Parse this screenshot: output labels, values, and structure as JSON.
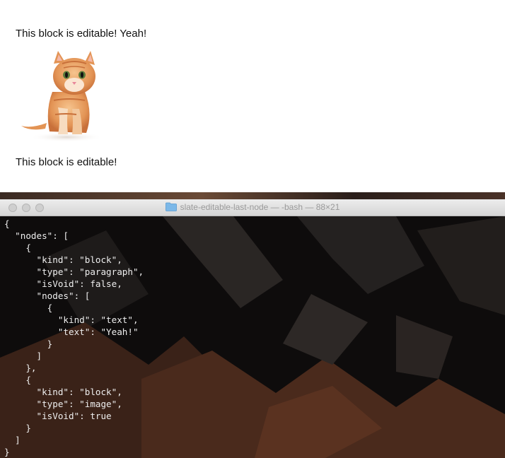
{
  "editor": {
    "paragraph_1": "This block is editable! Yeah!",
    "paragraph_2": "This block is editable!",
    "image_icon": "kitten-image"
  },
  "terminal": {
    "title": "slate-editable-last-node — -bash — 88×21",
    "folder_icon": "folder-icon",
    "lines": [
      "{",
      "  \"nodes\": [",
      "    {",
      "      \"kind\": \"block\",",
      "      \"type\": \"paragraph\",",
      "      \"isVoid\": false,",
      "      \"nodes\": [",
      "        {",
      "          \"kind\": \"text\",",
      "          \"text\": \"Yeah!\"",
      "        }",
      "      ]",
      "    },",
      "    {",
      "      \"kind\": \"block\",",
      "      \"type\": \"image\",",
      "      \"isVoid\": true",
      "    }",
      "  ]",
      "}"
    ]
  },
  "colors": {
    "editor_bg": "#ffffff",
    "terminal_bg": "#0d0b0b",
    "terminal_text": "#eeeeee",
    "titlebar": "#e2e2e2"
  }
}
